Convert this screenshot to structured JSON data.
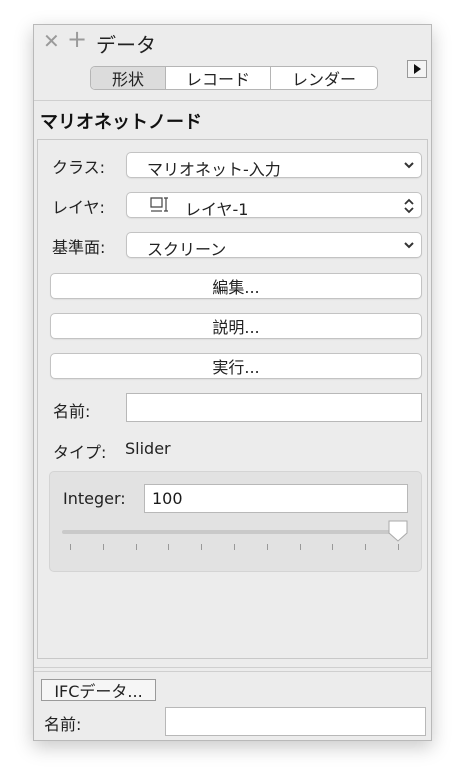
{
  "window": {
    "title": "データ",
    "close_glyph": "✕",
    "add_glyph": "+"
  },
  "tabs": [
    {
      "label": "形状",
      "active": true
    },
    {
      "label": "レコード",
      "active": false
    },
    {
      "label": "レンダー",
      "active": false
    }
  ],
  "section_title": "マリオネットノード",
  "fields": {
    "class_label": "クラス:",
    "class_value": "マリオネット-入力",
    "layer_label": "レイヤ:",
    "layer_value": "レイヤ-1",
    "plane_label": "基準面:",
    "plane_value": "スクリーン",
    "name_label": "名前:",
    "name_value": "",
    "type_label": "タイプ:",
    "type_value": "Slider"
  },
  "buttons": {
    "edit": "編集...",
    "describe": "説明...",
    "run": "実行..."
  },
  "slider": {
    "label": "Integer:",
    "value": "100",
    "position": 1.0,
    "tick_count": 11
  },
  "footer": {
    "ifc_button": "IFCデータ...",
    "name_label": "名前:",
    "name_value": ""
  },
  "icons": {
    "close": "close-icon",
    "add": "add-icon",
    "expand": "play-triangle-icon",
    "layer": "layer-icon",
    "popup": "chevron-down-icon",
    "stepper": "updown-chevron-icon"
  }
}
